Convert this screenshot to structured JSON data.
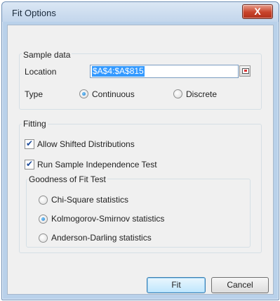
{
  "window": {
    "title": "Fit Options",
    "close_glyph": "X"
  },
  "sample_data": {
    "group_label": "Sample data",
    "location_label": "Location",
    "location_value": "$A$4:$A$815",
    "type_label": "Type",
    "type_options": [
      "Continuous",
      "Discrete"
    ],
    "type_selected": "Continuous",
    "ref_icon": "range-select-icon"
  },
  "fitting": {
    "group_label": "Fitting",
    "allow_shifted": {
      "label": "Allow Shifted Distributions",
      "checked": true
    },
    "run_independence": {
      "label": "Run Sample Independence Test",
      "checked": true
    },
    "gof": {
      "group_label": "Goodness of Fit Test",
      "options": [
        "Chi-Square statistics",
        "Kolmogorov-Smirnov statistics",
        "Anderson-Darling statistics"
      ],
      "selected": "Kolmogorov-Smirnov statistics"
    }
  },
  "buttons": {
    "fit": "Fit",
    "cancel": "Cancel"
  }
}
